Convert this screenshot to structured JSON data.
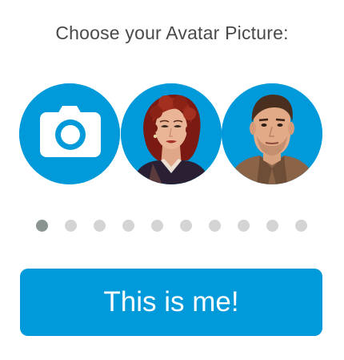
{
  "prompt": {
    "title": "Choose your Avatar Picture:"
  },
  "avatars": [
    {
      "name": "camera-upload",
      "icon": "camera-icon",
      "selected": true
    },
    {
      "name": "woman-portrait",
      "icon": "red-haired-woman-illustration",
      "selected": false
    },
    {
      "name": "man-portrait",
      "icon": "brown-haired-man-illustration",
      "selected": false
    }
  ],
  "pagination": {
    "total": 10,
    "active_index": 0
  },
  "cta": {
    "label": "This is me!"
  },
  "colors": {
    "accent": "#0099d9",
    "dot_active": "#8a9592",
    "dot_inactive": "#d4d4d4",
    "title_text": "#4a4a4a",
    "button_text": "#ffffff"
  }
}
